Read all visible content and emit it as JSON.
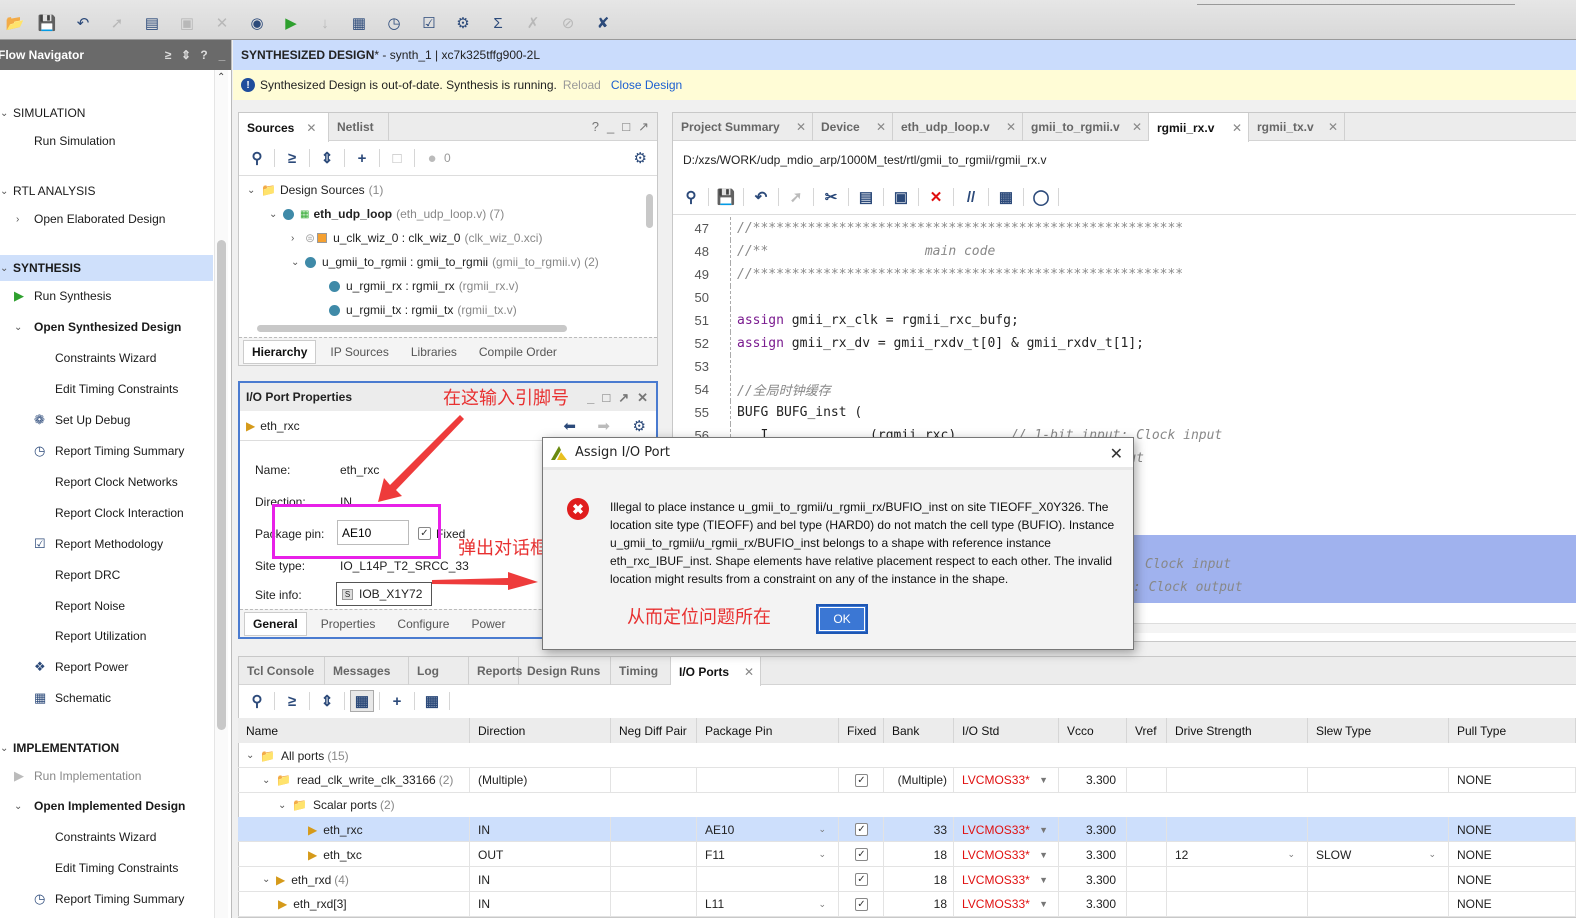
{
  "toolbar": {
    "icons": [
      "open-project-icon",
      "save-icon",
      "undo-icon",
      "redo-icon",
      "copy-icon",
      "paste-icon",
      "delete-icon",
      "find-icon",
      "run-icon",
      "step-icon",
      "schematic-icon",
      "timer-icon",
      "report-icon",
      "settings-icon",
      "sigma-icon",
      "disabled-icon-1",
      "disabled-icon-2",
      "tool-icon"
    ]
  },
  "flow_navigator": {
    "title": "Flow Navigator",
    "items": [
      {
        "label": "SIMULATION",
        "type": "section"
      },
      {
        "label": "Run Simulation",
        "type": "item"
      },
      {
        "label": "RTL ANALYSIS",
        "type": "section"
      },
      {
        "label": "Open Elaborated Design",
        "type": "sub"
      },
      {
        "label": "SYNTHESIS",
        "type": "section-selected"
      },
      {
        "label": "Run Synthesis",
        "type": "run"
      },
      {
        "label": "Open Synthesized Design",
        "type": "sub-open"
      },
      {
        "label": "Constraints Wizard",
        "type": "leaf"
      },
      {
        "label": "Edit Timing Constraints",
        "type": "leaf"
      },
      {
        "label": "Set Up Debug",
        "type": "leaf-icon",
        "icon": "bug-icon"
      },
      {
        "label": "Report Timing Summary",
        "type": "leaf-icon",
        "icon": "stopwatch-icon"
      },
      {
        "label": "Report Clock Networks",
        "type": "leaf"
      },
      {
        "label": "Report Clock Interaction",
        "type": "leaf"
      },
      {
        "label": "Report Methodology",
        "type": "leaf-icon",
        "icon": "clipboard-icon"
      },
      {
        "label": "Report DRC",
        "type": "leaf"
      },
      {
        "label": "Report Noise",
        "type": "leaf"
      },
      {
        "label": "Report Utilization",
        "type": "leaf"
      },
      {
        "label": "Report Power",
        "type": "leaf-icon",
        "icon": "power-plug-icon"
      },
      {
        "label": "Schematic",
        "type": "leaf-icon",
        "icon": "schematic-icon"
      },
      {
        "label": "IMPLEMENTATION",
        "type": "section-bold"
      },
      {
        "label": "Run Implementation",
        "type": "run-disabled"
      },
      {
        "label": "Open Implemented Design",
        "type": "sub-open"
      },
      {
        "label": "Constraints Wizard",
        "type": "leaf"
      },
      {
        "label": "Edit Timing Constraints",
        "type": "leaf"
      },
      {
        "label": "Report Timing Summary",
        "type": "leaf-icon",
        "icon": "stopwatch-icon"
      }
    ]
  },
  "design_header": {
    "title_bold": "SYNTHESIZED DESIGN",
    "title_rest": " * - synth_1 | xc7k325tffg900-2L"
  },
  "warning_bar": {
    "message": "Synthesized Design is out-of-date. Synthesis is running.",
    "reload": "Reload",
    "close_design": "Close Design"
  },
  "sources": {
    "tabs": [
      "Sources",
      "Netlist"
    ],
    "issue_count": "0",
    "tree": [
      {
        "name": "Design Sources",
        "extra": "(1)"
      },
      {
        "name": "eth_udp_loop",
        "extra": "(eth_udp_loop.v) (7)"
      },
      {
        "name": "u_clk_wiz_0 : clk_wiz_0",
        "extra": "(clk_wiz_0.xci)"
      },
      {
        "name": "u_gmii_to_rgmii : gmii_to_rgmii",
        "extra": "(gmii_to_rgmii.v) (2)"
      },
      {
        "name": "u_rgmii_rx : rgmii_rx",
        "extra": "(rgmii_rx.v)"
      },
      {
        "name": "u_rgmii_tx : rgmii_tx",
        "extra": "(rgmii_tx.v)"
      }
    ],
    "bottom_tabs": [
      "Hierarchy",
      "IP Sources",
      "Libraries",
      "Compile Order"
    ]
  },
  "io_props": {
    "title": "I/O Port Properties",
    "port": "eth_rxc",
    "fields": {
      "name_label": "Name:",
      "name_value": "eth_rxc",
      "direction_label": "Direction:",
      "direction_value": "IN",
      "pin_label": "Package pin:",
      "pin_value": "AE10",
      "fixed_label": "Fixed",
      "site_type_label": "Site type:",
      "site_type_value": "IO_L14P_T2_SRCC_33",
      "site_info_label": "Site info:",
      "site_info_value": "IOB_X1Y72"
    },
    "tabs": [
      "General",
      "Properties",
      "Configure",
      "Power"
    ]
  },
  "editor": {
    "tabs": [
      "Project Summary",
      "Device",
      "eth_udp_loop.v",
      "gmii_to_rgmii.v",
      "rgmii_rx.v",
      "rgmii_tx.v"
    ],
    "active_tab": "rgmii_rx.v",
    "path": "D:/xzs/WORK/udp_mdio_arp/1000M_test/rtl/gmii_to_rgmii/rgmii_rx.v",
    "lines": [
      {
        "n": "47",
        "html": "<span class='cm'>//*******************************************************</span>"
      },
      {
        "n": "48",
        "html": "<span class='cm'>//**                    main code</span>"
      },
      {
        "n": "49",
        "html": "<span class='cm'>//*******************************************************</span>"
      },
      {
        "n": "50",
        "html": ""
      },
      {
        "n": "51",
        "html": "<span class='kw'>assign</span> gmii_rx_clk = rgmii_rxc_bufg;"
      },
      {
        "n": "52",
        "html": "<span class='kw'>assign</span> gmii_rx_dv = gmii_rxdv_t[0] &amp; gmii_rxdv_t[1];"
      },
      {
        "n": "53",
        "html": ""
      },
      {
        "n": "54",
        "html": "<span class='cm'>//全局时钟缓存</span>"
      },
      {
        "n": "55",
        "html": "BUFG BUFG_inst ("
      },
      {
        "n": "56",
        "html": "  .I             (rgmii_rxc),      <span class='cm'>// 1-bit input: Clock input</span>"
      },
      {
        "n": "57",
        "html": "                                   <span class='cm'>   : Clock output</span>"
      }
    ],
    "hidden_fragments": [
      "Clock input",
      ": Clock output"
    ]
  },
  "dialog": {
    "title": "Assign I/O Port",
    "message": "Illegal to place instance u_gmii_to_rgmii/u_rgmii_rx/BUFIO_inst on site TIEOFF_X0Y326. The location site type (TIEOFF) and bel type (HARD0) do not match the cell type (BUFIO). Instance u_gmii_to_rgmii/u_rgmii_rx/BUFIO_inst belongs to a shape with reference instance eth_rxc_IBUF_inst. Shape elements have relative placement respect to each other. The invalid location might results from a constraint on any of the instance in the shape.",
    "ok": "OK"
  },
  "annotations": {
    "enter_pin": "在这输入引脚号",
    "popup": "弹出对话框",
    "locate": "从而定位问题所在"
  },
  "console": {
    "tabs": [
      "Tcl Console",
      "Messages",
      "Log",
      "Reports",
      "Design Runs",
      "Timing",
      "I/O Ports"
    ],
    "active_tab": "I/O Ports",
    "columns": [
      "Name",
      "Direction",
      "Neg Diff Pair",
      "Package Pin",
      "Fixed",
      "Bank",
      "I/O Std",
      "Vcco",
      "Vref",
      "Drive Strength",
      "Slew Type",
      "Pull Type"
    ],
    "rows": [
      {
        "level": 0,
        "name": "All ports",
        "count": "(15)",
        "direction": "",
        "pin": "",
        "fixed": false,
        "bank": "",
        "iostd": "",
        "vcco": "",
        "drive": "",
        "slew": "",
        "pull": ""
      },
      {
        "level": 1,
        "name": "read_clk_write_clk_33166",
        "count": "(2)",
        "direction": "(Multiple)",
        "pin": "",
        "fixed": true,
        "bank": "(Multiple)",
        "iostd": "LVCMOS33*",
        "vcco": "3.300",
        "drive": "",
        "slew": "",
        "pull": "NONE"
      },
      {
        "level": 2,
        "name": "Scalar ports",
        "count": "(2)",
        "direction": "",
        "pin": "",
        "fixed": false,
        "bank": "",
        "iostd": "",
        "vcco": "",
        "drive": "",
        "slew": "",
        "pull": ""
      },
      {
        "level": 3,
        "name": "eth_rxc",
        "count": "",
        "direction": "IN",
        "pin": "AE10",
        "fixed": true,
        "bank": "33",
        "iostd": "LVCMOS33*",
        "vcco": "3.300",
        "drive": "",
        "slew": "",
        "pull": "NONE",
        "selected": true
      },
      {
        "level": 3,
        "name": "eth_txc",
        "count": "",
        "direction": "OUT",
        "pin": "F11",
        "fixed": true,
        "bank": "18",
        "iostd": "LVCMOS33*",
        "vcco": "3.300",
        "drive": "12",
        "slew": "SLOW",
        "pull": "NONE"
      },
      {
        "level": 1,
        "name": "eth_rxd",
        "count": "(4)",
        "direction": "IN",
        "pin": "",
        "fixed": true,
        "bank": "18",
        "iostd": "LVCMOS33*",
        "vcco": "3.300",
        "drive": "",
        "slew": "",
        "pull": "NONE"
      },
      {
        "level": 2,
        "name": "eth_rxd[3]",
        "count": "",
        "direction": "IN",
        "pin": "L11",
        "fixed": true,
        "bank": "18",
        "iostd": "LVCMOS33*",
        "vcco": "3.300",
        "drive": "",
        "slew": "",
        "pull": "NONE"
      }
    ]
  }
}
